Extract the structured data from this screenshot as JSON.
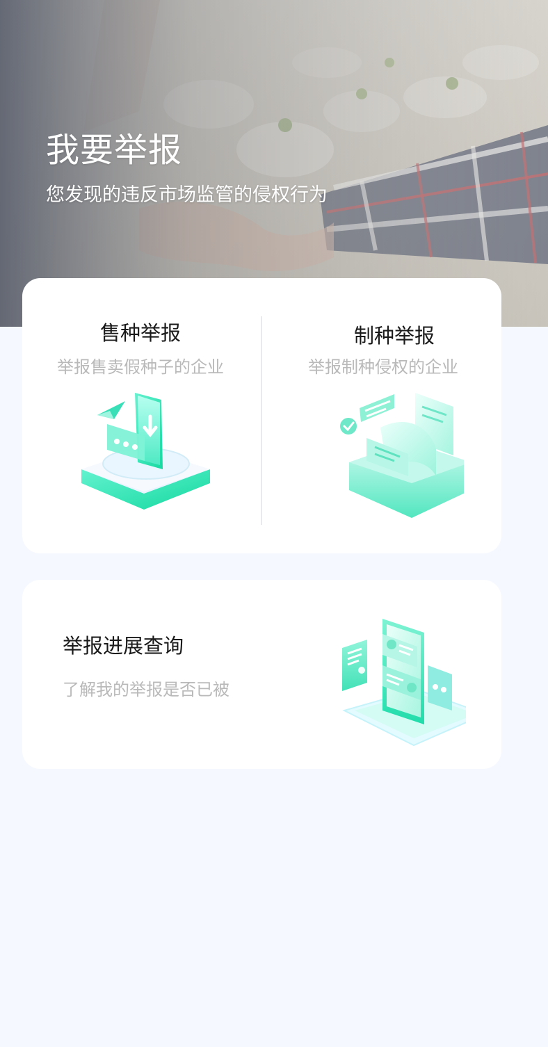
{
  "hero": {
    "title": "我要举报",
    "subtitle": "您发现的违反市场监管的侵权行为"
  },
  "report_options": [
    {
      "title": "售种举报",
      "description": "举报售卖假种子的企业",
      "icon": "seed-sale-report-illustration"
    },
    {
      "title": "制种举报",
      "description": "举报制种侵权的企业",
      "icon": "seed-production-report-illustration"
    }
  ],
  "progress": {
    "title": "举报进展查询",
    "description": "了解我的举报是否已被",
    "icon": "report-progress-phone-illustration"
  },
  "colors": {
    "page_bg": "#f5f8ff",
    "card_bg": "#ffffff",
    "title": "#1a1a1a",
    "muted": "#b9b9b9",
    "accent": "#2ee8b6"
  }
}
